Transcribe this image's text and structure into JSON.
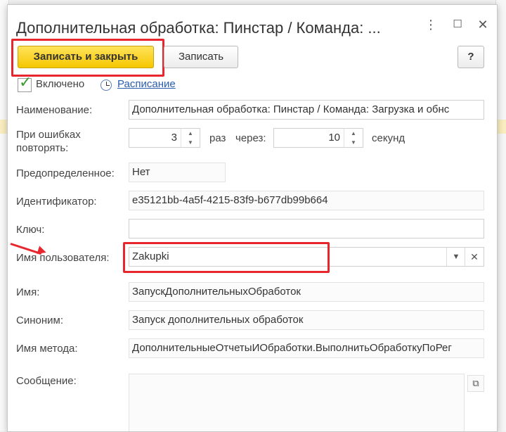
{
  "window": {
    "title": "Дополнительная обработка: Пинстар / Команда: ...",
    "more_icon": "more-vertical-icon",
    "maximize_icon": "maximize-icon",
    "close_icon": "close-icon"
  },
  "toolbar": {
    "save_close_label": "Записать и закрыть",
    "save_label": "Записать",
    "help_label": "?"
  },
  "enabled": {
    "label": "Включено",
    "checked": true
  },
  "schedule": {
    "label": "Расписание",
    "icon": "clock-icon"
  },
  "fields": {
    "name": {
      "label": "Наименование:",
      "value": "Дополнительная обработка: Пинстар / Команда: Загрузка и обнс"
    },
    "retry": {
      "label": "При ошибках\nповторять:",
      "label_line1": "При ошибках",
      "label_line2": "повторять:",
      "count": "3",
      "times_label": "раз",
      "interval_label": "через:",
      "interval": "10",
      "seconds_label": "секунд"
    },
    "predefined": {
      "label": "Предопределенное:",
      "value": "Нет"
    },
    "identifier": {
      "label": "Идентификатор:",
      "value": "e35121bb-4a5f-4215-83f9-b677db99b664"
    },
    "key": {
      "label": "Ключ:",
      "value": ""
    },
    "username": {
      "label": "Имя пользователя:",
      "value": "Zakupki"
    },
    "method_name_short": {
      "label": "Имя:",
      "value": "ЗапускДополнительныхОбработок"
    },
    "synonym": {
      "label": "Синоним:",
      "value": "Запуск дополнительных обработок"
    },
    "method": {
      "label": "Имя метода:",
      "value": "ДополнительныеОтчетыИОбработки.ВыполнитьОбработкуПоРег"
    },
    "message": {
      "label": "Сообщение:",
      "value": ""
    }
  },
  "colors": {
    "accent_yellow": "#f5c700",
    "highlight_red": "#e8262d",
    "link_blue": "#2a5db0"
  }
}
